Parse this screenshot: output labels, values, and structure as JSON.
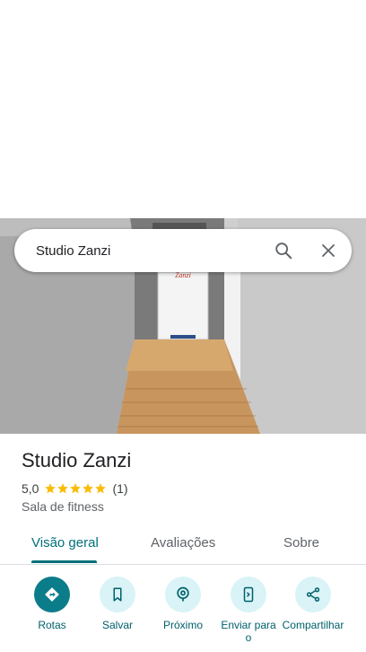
{
  "search": {
    "query": "Studio Zanzi"
  },
  "photo": {
    "sign_text": "Zanzi"
  },
  "place": {
    "name": "Studio Zanzi",
    "rating": "5,0",
    "stars": 5,
    "review_count": "(1)",
    "category": "Sala de fitness"
  },
  "tabs": [
    {
      "label": "Visão geral",
      "active": true
    },
    {
      "label": "Avaliações",
      "active": false
    },
    {
      "label": "Sobre",
      "active": false
    }
  ],
  "actions": [
    {
      "label": "Rotas",
      "icon": "directions-icon"
    },
    {
      "label": "Salvar",
      "icon": "bookmark-icon"
    },
    {
      "label": "Próximo",
      "icon": "nearby-icon"
    },
    {
      "label": "Enviar para o",
      "icon": "send-to-phone-icon"
    },
    {
      "label": "Compartilhar",
      "icon": "share-icon"
    }
  ],
  "colors": {
    "accent": "#00707a",
    "primary_button": "#0b7c8a",
    "star": "#fbbc04"
  }
}
